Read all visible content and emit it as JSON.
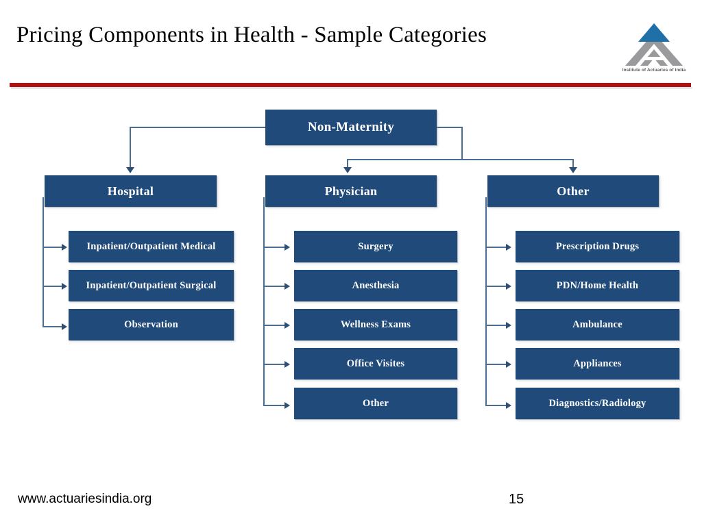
{
  "slide": {
    "title": "Pricing Components in Health  - Sample Categories",
    "accent_red": "#b20f14",
    "node_blue": "#1f4a7a",
    "connector_blue": "#4a6d92"
  },
  "logo": {
    "caption": "Institute of Actuaries of India",
    "triangle_top_color": "#1f6fa8",
    "triangle_base_color": "#9a9a9c"
  },
  "diagram": {
    "root": {
      "label": "Non-Maternity"
    },
    "branches": [
      {
        "label": "Hospital",
        "children": [
          {
            "label": "Inpatient/Outpatient Medical"
          },
          {
            "label": "Inpatient/Outpatient Surgical"
          },
          {
            "label": "Observation"
          }
        ]
      },
      {
        "label": "Physician",
        "children": [
          {
            "label": "Surgery"
          },
          {
            "label": "Anesthesia"
          },
          {
            "label": "Wellness Exams"
          },
          {
            "label": "Office Visites"
          },
          {
            "label": "Other"
          }
        ]
      },
      {
        "label": "Other",
        "children": [
          {
            "label": "Prescription Drugs"
          },
          {
            "label": "PDN/Home Health"
          },
          {
            "label": "Ambulance"
          },
          {
            "label": "Appliances"
          },
          {
            "label": "Diagnostics/Radiology"
          }
        ]
      }
    ]
  },
  "footer": {
    "url": "www.actuariesindia.org",
    "page_number": "15"
  }
}
